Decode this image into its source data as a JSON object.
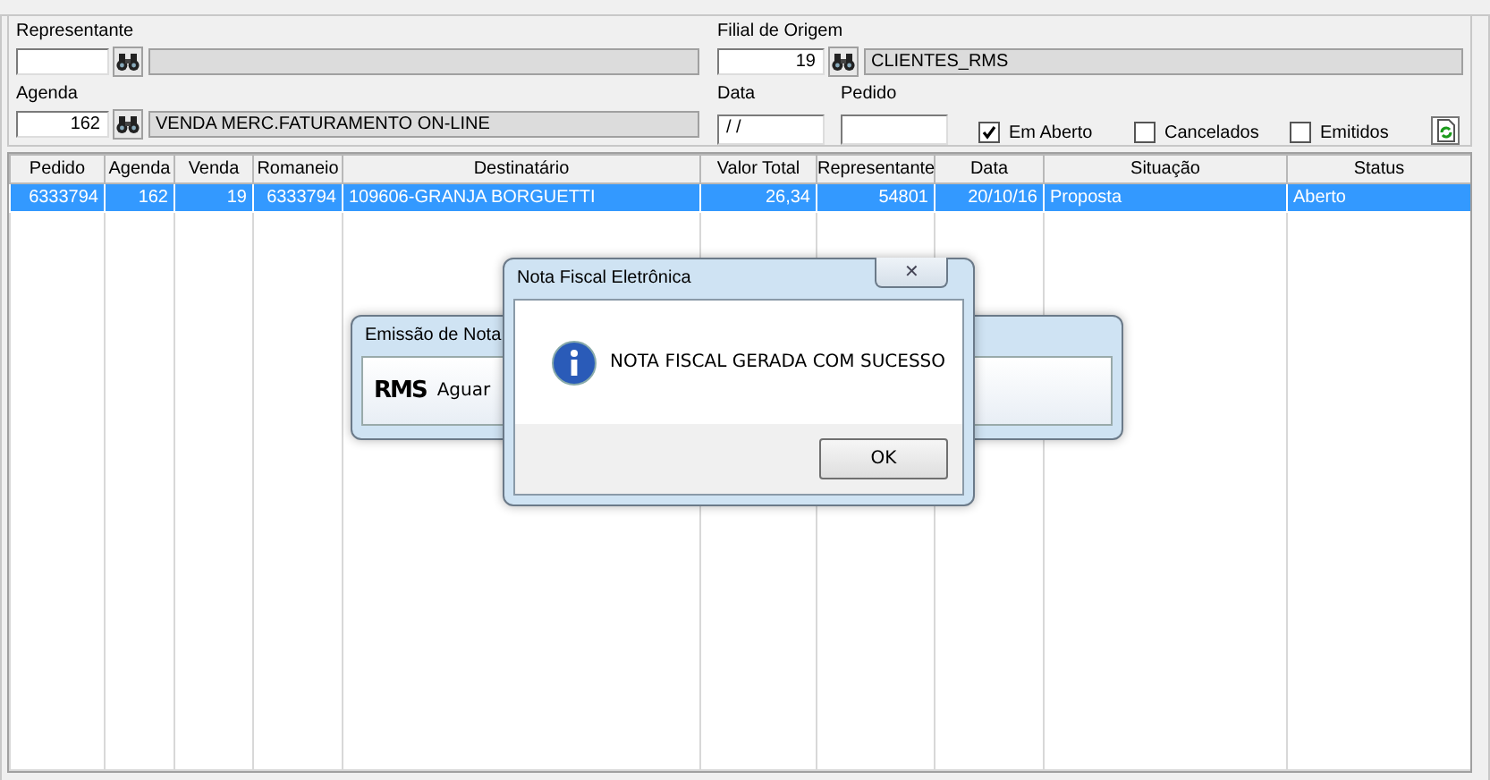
{
  "filters": {
    "left": [
      {
        "label": "Representante"
      },
      {
        "label": "Agenda",
        "value": "162",
        "description": "VENDA MERC.FATURAMENTO ON-LINE"
      }
    ],
    "filial": {
      "label": "Filial de Origem",
      "value": "19",
      "description": "CLIENTES_RMS"
    },
    "data": {
      "label": "Data",
      "value": " / /"
    },
    "pedido": {
      "label": "Pedido"
    },
    "checkboxes": [
      {
        "label": "Em Aberto",
        "checked": true
      },
      {
        "label": "Cancelados",
        "checked": false
      },
      {
        "label": "Emitidos",
        "checked": false
      }
    ]
  },
  "table": {
    "columns": [
      "Pedido",
      "Agenda",
      "Venda",
      "Romaneio",
      "Destinatário",
      "Valor Total",
      "Representante",
      "Data",
      "Situação",
      "Status"
    ],
    "rows": [
      {
        "cells": [
          "6333794",
          "162",
          "19",
          "6333794",
          "109606-GRANJA BORGUETTI",
          "26,34",
          "54801",
          "20/10/16",
          "Proposta",
          "Aberto"
        ],
        "selected": true
      }
    ]
  },
  "progress_dialog": {
    "title": "Emissão de Nota",
    "logo": "RMS",
    "text": "Aguar"
  },
  "message_dialog": {
    "title": "Nota Fiscal Eletrônica",
    "close": "✕",
    "message": "NOTA FISCAL GERADA COM SUCESSO",
    "button": "OK"
  }
}
